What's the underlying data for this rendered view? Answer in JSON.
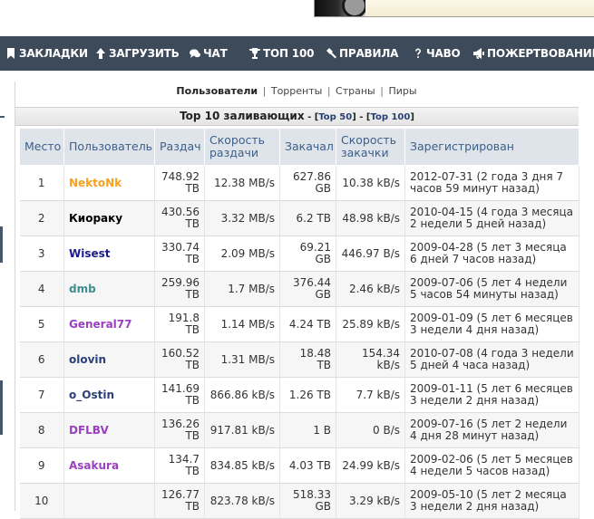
{
  "nav": {
    "items": [
      {
        "label": "ЗАКЛАДКИ",
        "icon": "bookmark-icon"
      },
      {
        "label": "ЗАГРУЗИТЬ",
        "icon": "arrow-up-icon"
      },
      {
        "label": "ЧАТ",
        "icon": "chat-bubbles-icon"
      },
      {
        "label": "ТОП 100",
        "icon": "trophy-icon"
      },
      {
        "label": "ПРАВИЛА",
        "icon": "gavel-icon"
      },
      {
        "label": "ЧАВО",
        "icon": "question-mark-icon"
      },
      {
        "label": "ПОЖЕРТВОВАНИЕ",
        "icon": "megaphone-icon"
      }
    ]
  },
  "subnav": {
    "active": "Пользователи",
    "links": [
      "Торренты",
      "Страны",
      "Пиры"
    ],
    "separator": "|"
  },
  "section": {
    "title": "Top 10 заливающих",
    "dash": " - [",
    "link_top50": "Top 50",
    "between": "] - [",
    "link_top100": "Top 100",
    "end": "]"
  },
  "table": {
    "headers": {
      "place": "Место",
      "user": "Пользователь",
      "uploaded": "Раздач",
      "up_speed": "Скорость раздачи",
      "downloaded": "Закачал",
      "down_speed": "Скорость закачки",
      "registered": "Зарегистрирован"
    },
    "rows": [
      {
        "place": "1",
        "user": "NektoNk",
        "color": "#f7a11f",
        "uploaded": "748.92 TB",
        "up_speed": "12.38 MB/s",
        "downloaded": "627.86 GB",
        "down_speed": "10.38 kB/s",
        "registered": "2012-07-31 (2 года 3 дня 7 часов 59 минут назад)"
      },
      {
        "place": "2",
        "user": "Киораку",
        "color": "#000000",
        "uploaded": "430.56 TB",
        "up_speed": "3.32 MB/s",
        "downloaded": "6.2 TB",
        "down_speed": "48.98 kB/s",
        "registered": "2010-04-15 (4 года 3 месяца 2 недели 5 дней назад)"
      },
      {
        "place": "3",
        "user": "Wisest",
        "color": "#1b1b8e",
        "uploaded": "330.74 TB",
        "up_speed": "2.09 MB/s",
        "downloaded": "69.21 GB",
        "down_speed": "446.97 B/s",
        "registered": "2009-04-28 (5 лет 3 месяца 6 дней 7 часов назад)"
      },
      {
        "place": "4",
        "user": "dmb",
        "color": "#3e8e8e",
        "uploaded": "259.96 TB",
        "up_speed": "1.7 MB/s",
        "downloaded": "376.44 GB",
        "down_speed": "2.46 kB/s",
        "registered": "2009-07-06 (5 лет 4 недели 5 часов 54 минуты назад)"
      },
      {
        "place": "5",
        "user": "General77",
        "color": "#9a3fc0",
        "uploaded": "191.8 TB",
        "up_speed": "1.14 MB/s",
        "downloaded": "4.24 TB",
        "down_speed": "25.89 kB/s",
        "registered": "2009-01-09 (5 лет 6 месяцев 3 недели 4 дня назад)"
      },
      {
        "place": "6",
        "user": "olovin",
        "color": "#2b3f7a",
        "uploaded": "160.52 TB",
        "up_speed": "1.31 MB/s",
        "downloaded": "18.48 TB",
        "down_speed": "154.34 kB/s",
        "registered": "2010-07-08 (4 года 3 недели 5 дней 4 часа назад)"
      },
      {
        "place": "7",
        "user": "o_Ostin",
        "color": "#2b3f7a",
        "uploaded": "141.69 TB",
        "up_speed": "866.86 kB/s",
        "downloaded": "1.26 TB",
        "down_speed": "7.7 kB/s",
        "registered": "2009-01-11 (5 лет 6 месяцев 3 недели 2 дня назад)"
      },
      {
        "place": "8",
        "user": "DFLBV",
        "color": "#9a3fc0",
        "uploaded": "136.26 TB",
        "up_speed": "917.81 kB/s",
        "downloaded": "1 B",
        "down_speed": "0 B/s",
        "registered": "2009-07-16 (5 лет 2 недели 4 дня 28 минут назад)"
      },
      {
        "place": "9",
        "user": "Asakura",
        "color": "#9a3fc0",
        "uploaded": "134.7 TB",
        "up_speed": "834.85 kB/s",
        "downloaded": "4.03 TB",
        "down_speed": "24.99 kB/s",
        "registered": "2009-02-06 (5 лет 5 месяцев 4 недели 5 часов назад)"
      },
      {
        "place": "10",
        "user": "",
        "color": "#2b3f7a",
        "uploaded": "126.77 TB",
        "up_speed": "823.78 kB/s",
        "downloaded": "518.33 GB",
        "down_speed": "3.29 kB/s",
        "registered": "2009-05-10 (5 лет 2 месяца 3 недели 2 дня назад)"
      }
    ]
  }
}
